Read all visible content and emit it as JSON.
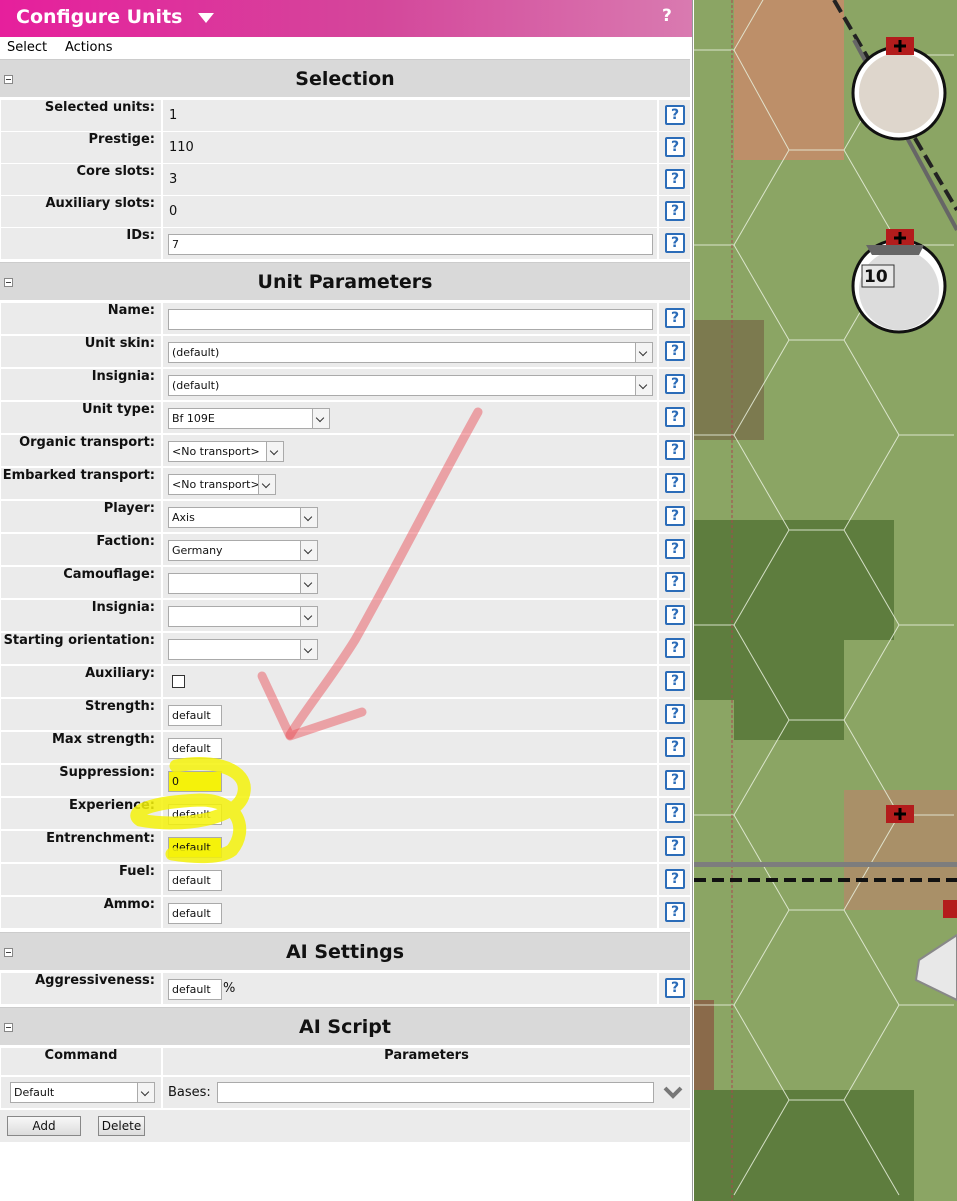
{
  "window": {
    "title": "Configure Units",
    "help": "?"
  },
  "menu": {
    "select": "Select",
    "actions": "Actions"
  },
  "sections": {
    "selection": "Selection",
    "unit_parameters": "Unit Parameters",
    "ai_settings": "AI Settings",
    "ai_script": "AI Script"
  },
  "help_glyph": "?",
  "selection": {
    "selected_units": {
      "label": "Selected units:",
      "value": "1"
    },
    "prestige": {
      "label": "Prestige:",
      "value": "110"
    },
    "core_slots": {
      "label": "Core slots:",
      "value": "3"
    },
    "auxiliary_slots": {
      "label": "Auxiliary slots:",
      "value": "0"
    },
    "ids": {
      "label": "IDs:",
      "value": "7"
    }
  },
  "unit_parameters": {
    "name": {
      "label": "Name:",
      "value": ""
    },
    "unit_skin": {
      "label": "Unit skin:",
      "value": "(default)"
    },
    "insignia1": {
      "label": "Insignia:",
      "value": "(default)"
    },
    "unit_type": {
      "label": "Unit type:",
      "value": "Bf 109E"
    },
    "organic_transport": {
      "label": "Organic transport:",
      "value": "<No transport>"
    },
    "embarked_transport": {
      "label": "Embarked transport:",
      "value": "<No transport>"
    },
    "player": {
      "label": "Player:",
      "value": "Axis"
    },
    "faction": {
      "label": "Faction:",
      "value": "Germany"
    },
    "camouflage": {
      "label": "Camouflage:",
      "value": ""
    },
    "insignia2": {
      "label": "Insignia:",
      "value": ""
    },
    "starting_orientation": {
      "label": "Starting orientation:",
      "value": ""
    },
    "auxiliary": {
      "label": "Auxiliary:",
      "checked": false
    },
    "strength": {
      "label": "Strength:",
      "value": "default"
    },
    "max_strength": {
      "label": "Max strength:",
      "value": "default"
    },
    "suppression": {
      "label": "Suppression:",
      "value": "0"
    },
    "experience": {
      "label": "Experience:",
      "value": "default"
    },
    "entrenchment": {
      "label": "Entrenchment:",
      "value": "default"
    },
    "fuel": {
      "label": "Fuel:",
      "value": "default"
    },
    "ammo": {
      "label": "Ammo:",
      "value": "default"
    }
  },
  "ai_settings": {
    "aggressiveness": {
      "label": "Aggressiveness:",
      "value": "default",
      "unit": "%"
    }
  },
  "ai_script": {
    "columns": [
      "Command",
      "Parameters"
    ],
    "command_value": "Default",
    "bases_label": "Bases:",
    "bases_value": "",
    "add_label": "Add",
    "delete_label": "Delete"
  },
  "map": {
    "unit_strength_badge": "10"
  },
  "colors": {
    "title_gradient_start": "#e61f9c",
    "help_icon": "#2b6cb8",
    "highlight": "#f5f20a",
    "annotation_arrow": "#e8474f"
  }
}
